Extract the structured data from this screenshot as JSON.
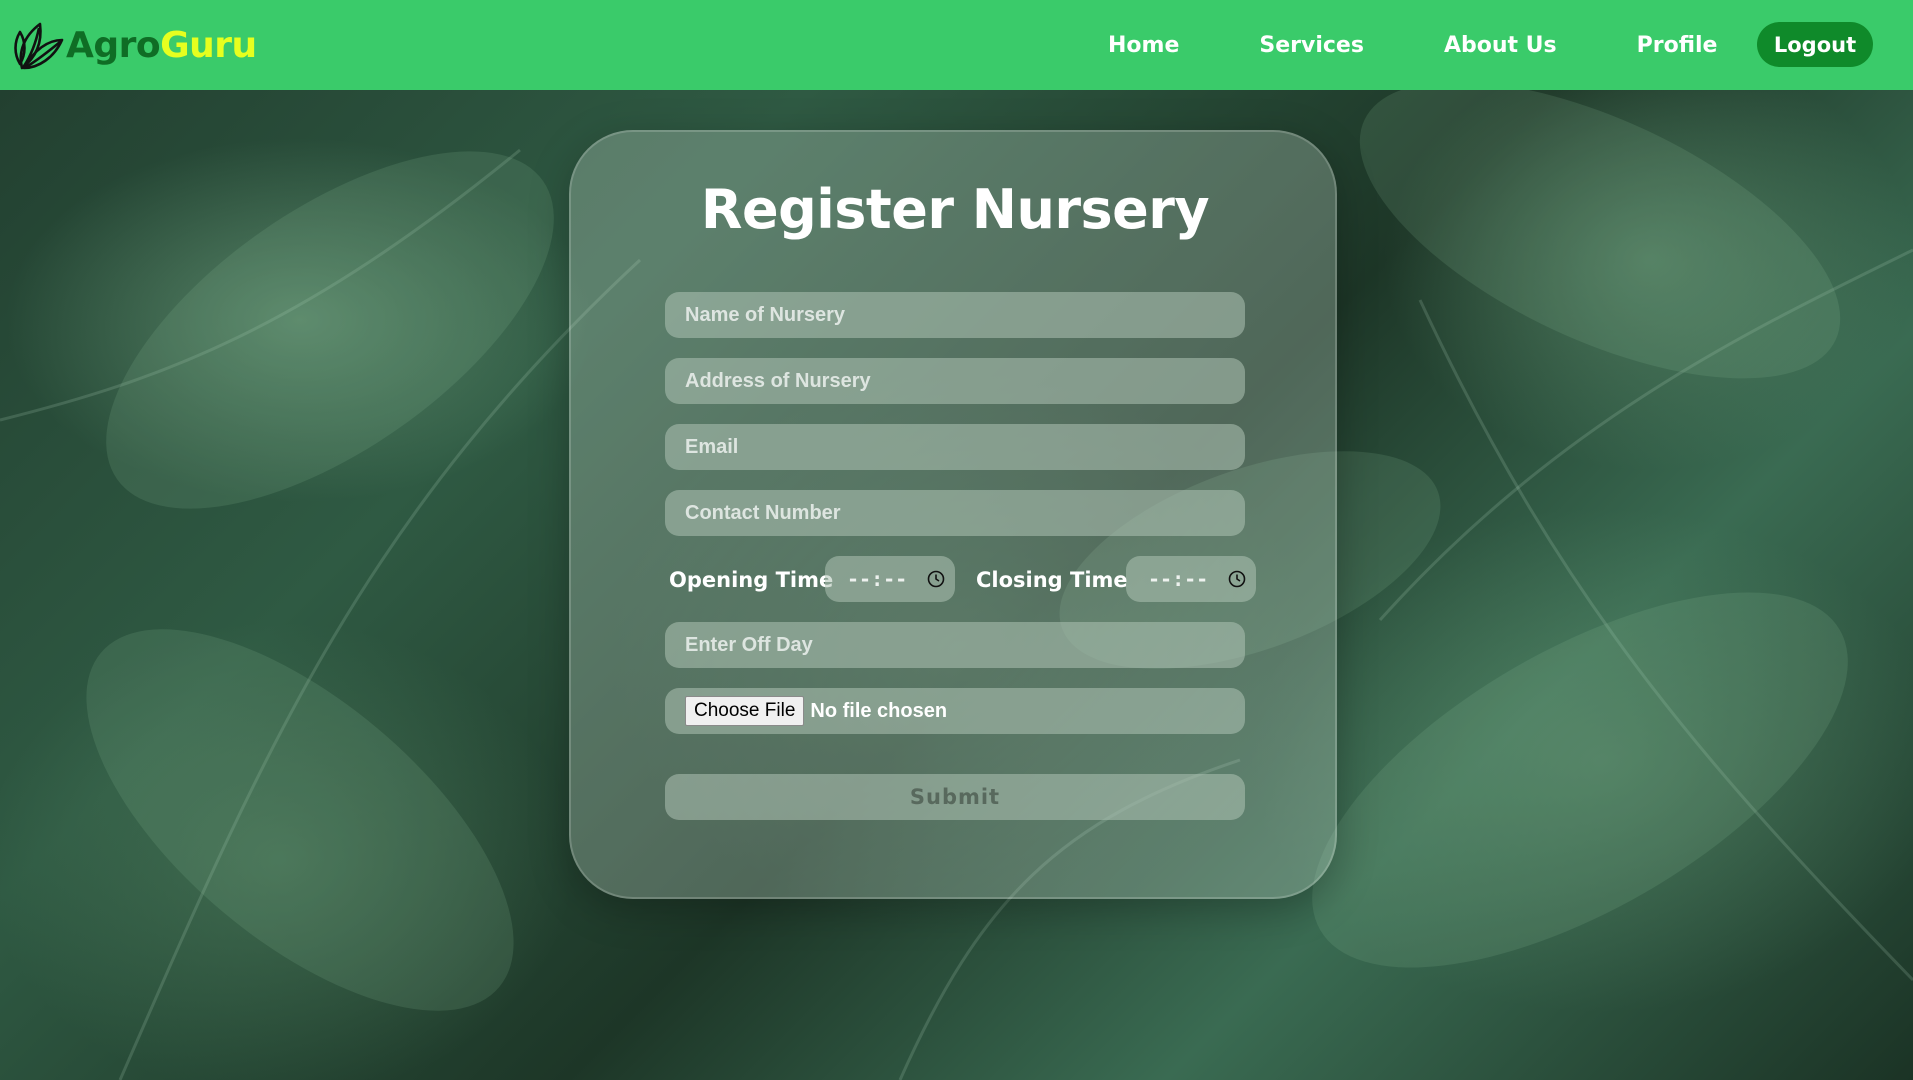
{
  "brand": {
    "part1": "Agro",
    "part2": "Guru",
    "logo_icon": "leaf-icon"
  },
  "nav": {
    "items": [
      {
        "label": "Home"
      },
      {
        "label": "Services"
      },
      {
        "label": "About Us"
      },
      {
        "label": "Profile"
      }
    ],
    "logout_label": "Logout"
  },
  "form": {
    "title": "Register Nursery",
    "name_placeholder": "Name of Nursery",
    "address_placeholder": "Address of Nursery",
    "email_placeholder": "Email",
    "contact_placeholder": "Contact Number",
    "opening_time_label": "Opening Time",
    "opening_time_value": "--:--",
    "closing_time_label": "Closing Time",
    "closing_time_value": "--:--",
    "off_day_placeholder": "Enter Off Day",
    "file_button_label": "Choose File",
    "file_status": "No file chosen",
    "submit_label": "Submit"
  },
  "colors": {
    "navbar": "#3acb6a",
    "brand_dark": "#0f6d25",
    "brand_accent": "#e6ff1f",
    "logout_bg": "#0f8a2a"
  }
}
